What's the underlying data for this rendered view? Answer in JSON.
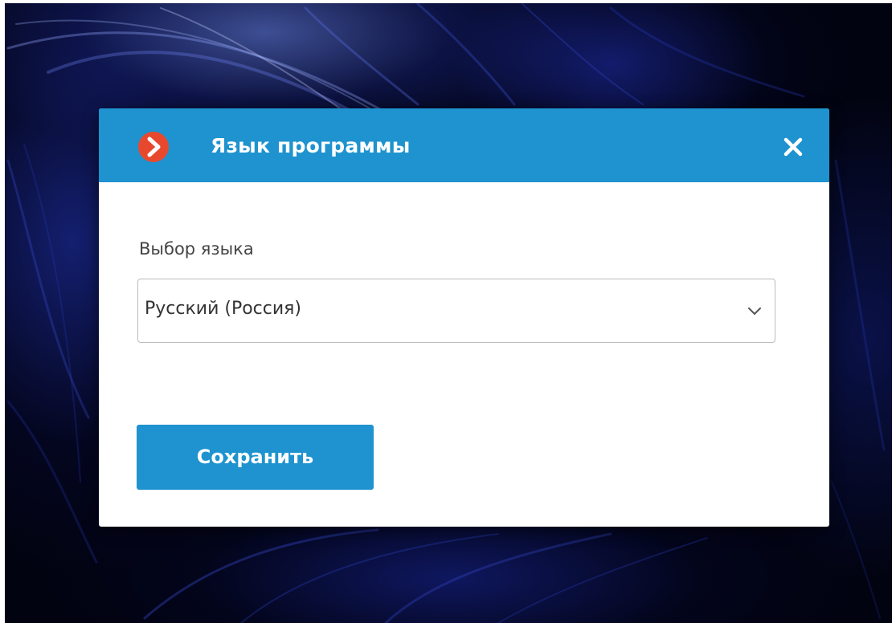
{
  "dialog": {
    "title": "Язык программы",
    "logo_icon": "chevron-right-circle-icon",
    "close_icon": "close-icon",
    "colors": {
      "header": "#1e93cf",
      "logo": "#e8492e",
      "button": "#1e93cf"
    }
  },
  "language": {
    "label": "Выбор языка",
    "selected": "Русский (Россия)",
    "dropdown_icon": "chevron-down-icon"
  },
  "actions": {
    "save_label": "Сохранить"
  }
}
